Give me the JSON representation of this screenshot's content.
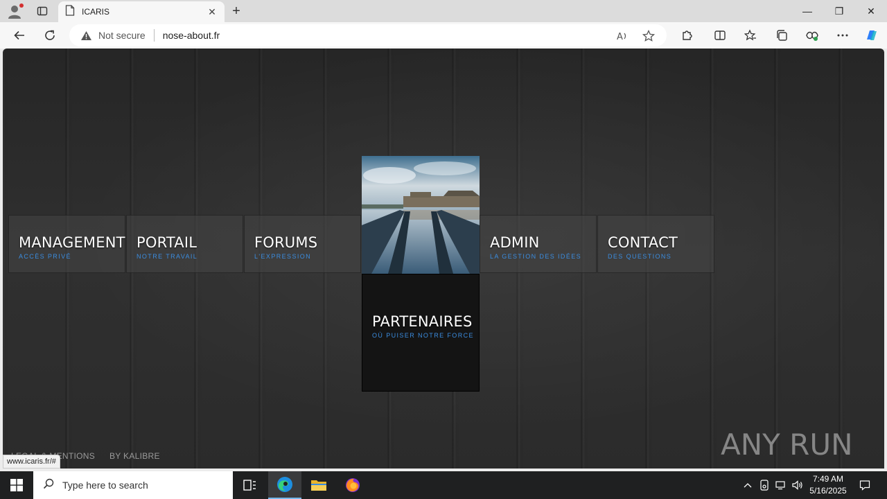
{
  "browser": {
    "tab": {
      "title": "ICARIS",
      "close_glyph": "✕"
    },
    "new_tab_glyph": "+",
    "window_controls": {
      "minimize": "—",
      "restore": "❐",
      "close": "✕"
    },
    "address": {
      "security_label": "Not secure",
      "url": "nose-about.fr"
    },
    "status_url": "www.icaris.fr/#"
  },
  "menu": {
    "items": [
      {
        "title": "MANAGEMENT",
        "subtitle": "ACCÈS PRIVÉ"
      },
      {
        "title": "PORTAIL",
        "subtitle": "NOTRE TRAVAIL"
      },
      {
        "title": "FORUMS",
        "subtitle": "L'EXPRESSION"
      },
      {
        "title": "ADMIN",
        "subtitle": "LA GESTION DES IDÉES"
      },
      {
        "title": "CONTACT",
        "subtitle": "DES QUESTIONS"
      }
    ],
    "featured": {
      "title": "PARTENAIRES",
      "subtitle": "OÙ PUISER NOTRE FORCE"
    }
  },
  "footer": {
    "legal": "LEGAL & MENTIONS",
    "credit": "BY KALIBRE"
  },
  "watermark": {
    "text": "ANY RUN"
  },
  "taskbar": {
    "search_placeholder": "Type here to search",
    "time": "7:49 AM",
    "date": "5/16/2025"
  },
  "colors": {
    "accent_sub": "#3b8de0",
    "page_bg": "#2b2b2b",
    "taskbar": "#1f2021"
  }
}
